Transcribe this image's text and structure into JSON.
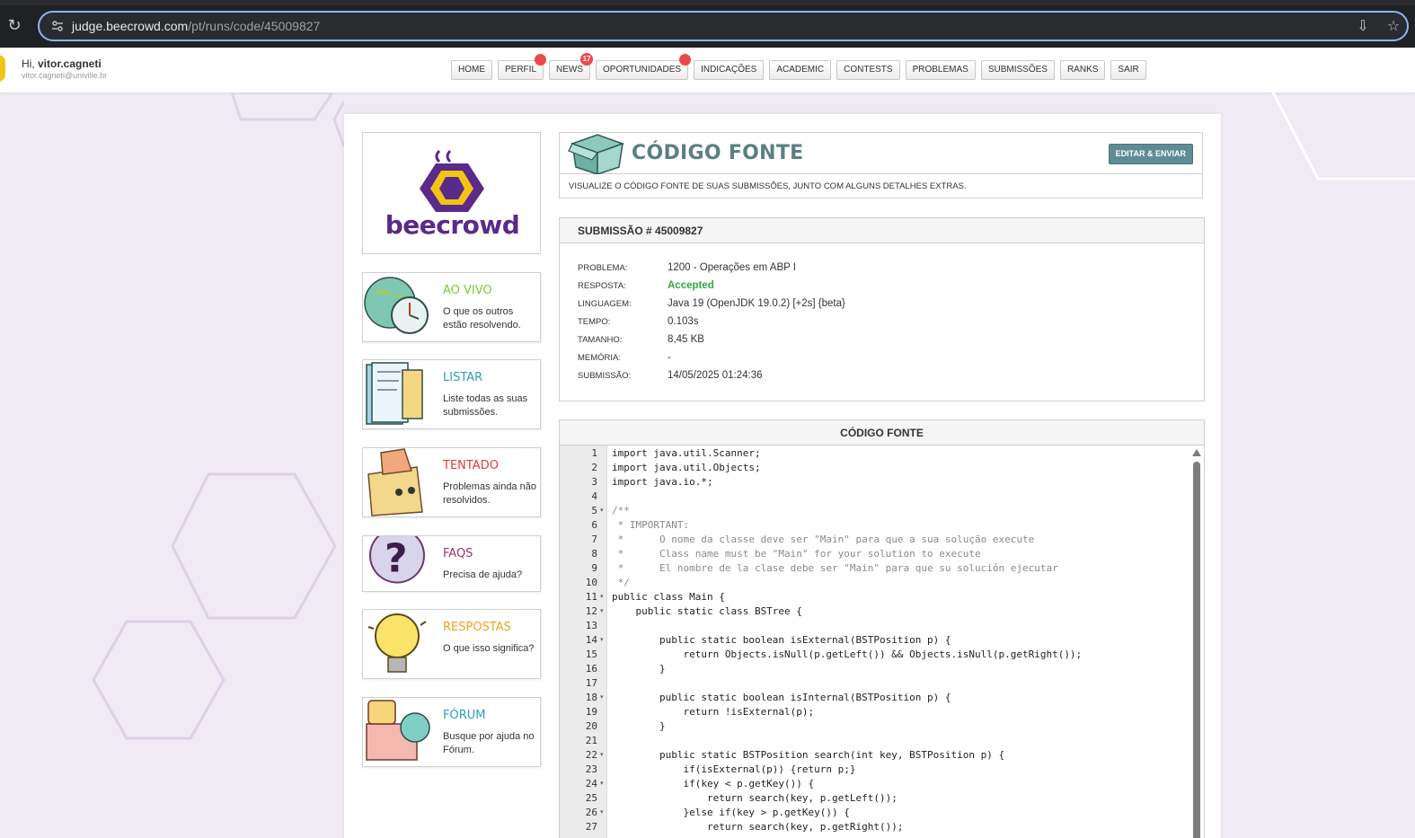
{
  "browser": {
    "url_host": "judge.beecrowd.com",
    "url_path": "/pt/runs/code/45009827"
  },
  "user": {
    "greeting_prefix": "Hi, ",
    "username": "vitor.cagneti",
    "email": "vitor.cagneti@univille.br"
  },
  "nav": {
    "items": [
      {
        "label": "HOME",
        "badge": ""
      },
      {
        "label": "PERFIL",
        "badge": ""
      },
      {
        "label": "NEWS",
        "badge": "17"
      },
      {
        "label": "OPORTUNIDADES",
        "badge": ""
      },
      {
        "label": "INDICAÇÕES",
        "badge": ""
      },
      {
        "label": "ACADEMIC",
        "badge": ""
      },
      {
        "label": "CONTESTS",
        "badge": ""
      },
      {
        "label": "PROBLEMAS",
        "badge": ""
      },
      {
        "label": "SUBMISSÕES",
        "badge": ""
      },
      {
        "label": "RANKS",
        "badge": ""
      },
      {
        "label": "SAIR",
        "badge": ""
      }
    ]
  },
  "logo": {
    "text": "beecrowd"
  },
  "sidebar": {
    "items": [
      {
        "title": "AO VIVO",
        "desc": "O que os outros estão resolvendo.",
        "color": "#7cc63a"
      },
      {
        "title": "LISTAR",
        "desc": "Liste todas as suas submissões.",
        "color": "#2aa0b8"
      },
      {
        "title": "TENTADO",
        "desc": "Problemas ainda não resolvidos.",
        "color": "#e23a3a"
      },
      {
        "title": "FAQS",
        "desc": "Precisa de ajuda?",
        "color": "#9b3470"
      },
      {
        "title": "RESPOSTAS",
        "desc": "O que isso significa?",
        "color": "#f2a01a"
      },
      {
        "title": "FÓRUM",
        "desc": "Busque por ajuda no Fórum.",
        "color": "#2aa0b8"
      }
    ]
  },
  "page": {
    "title": "CÓDIGO FONTE",
    "edit_button": "EDITAR & ENVIAR",
    "description": "VISUALIZE O CÓDIGO FONTE DE SUAS SUBMISSÕES, JUNTO COM ALGUNS DETALHES EXTRAS."
  },
  "submission": {
    "header": "SUBMISSÃO # 45009827",
    "details": [
      {
        "label": "PROBLEMA:",
        "value": "1200 - Operações em ABP I"
      },
      {
        "label": "RESPOSTA:",
        "value": "Accepted"
      },
      {
        "label": "LINGUAGEM:",
        "value": "Java 19 (OpenJDK 19.0.2) [+2s] {beta}"
      },
      {
        "label": "TEMPO:",
        "value": "0.103s"
      },
      {
        "label": "TAMANHO:",
        "value": "8,45 KB"
      },
      {
        "label": "MEMÓRIA:",
        "value": "-"
      },
      {
        "label": "SUBMISSÃO:",
        "value": "14/05/2025 01:24:36"
      }
    ]
  },
  "code": {
    "header": "CÓDIGO FONTE",
    "lines": [
      {
        "n": "1",
        "text": "import java.util.Scanner;",
        "fold": ""
      },
      {
        "n": "2",
        "text": "import java.util.Objects;",
        "fold": ""
      },
      {
        "n": "3",
        "text": "import java.io.*;",
        "fold": ""
      },
      {
        "n": "4",
        "text": "",
        "fold": ""
      },
      {
        "n": "5",
        "text": "/**",
        "fold": "▾"
      },
      {
        "n": "6",
        "text": " * IMPORTANT:",
        "fold": ""
      },
      {
        "n": "7",
        "text": " *      O nome da classe deve ser \"Main\" para que a sua solução execute",
        "fold": ""
      },
      {
        "n": "8",
        "text": " *      Class name must be \"Main\" for your solution to execute",
        "fold": ""
      },
      {
        "n": "9",
        "text": " *      El nombre de la clase debe ser \"Main\" para que su solución ejecutar",
        "fold": ""
      },
      {
        "n": "10",
        "text": " */",
        "fold": ""
      },
      {
        "n": "11",
        "text": "public class Main {",
        "fold": "▾"
      },
      {
        "n": "12",
        "text": "    public static class BSTree {",
        "fold": "▾"
      },
      {
        "n": "13",
        "text": "",
        "fold": ""
      },
      {
        "n": "14",
        "text": "        public static boolean isExternal(BSTPosition p) {",
        "fold": "▾"
      },
      {
        "n": "15",
        "text": "            return Objects.isNull(p.getLeft()) && Objects.isNull(p.getRight());",
        "fold": ""
      },
      {
        "n": "16",
        "text": "        }",
        "fold": ""
      },
      {
        "n": "17",
        "text": "",
        "fold": ""
      },
      {
        "n": "18",
        "text": "        public static boolean isInternal(BSTPosition p) {",
        "fold": "▾"
      },
      {
        "n": "19",
        "text": "            return !isExternal(p);",
        "fold": ""
      },
      {
        "n": "20",
        "text": "        }",
        "fold": ""
      },
      {
        "n": "21",
        "text": "",
        "fold": ""
      },
      {
        "n": "22",
        "text": "        public static BSTPosition search(int key, BSTPosition p) {",
        "fold": "▾"
      },
      {
        "n": "23",
        "text": "            if(isExternal(p)) {return p;}",
        "fold": ""
      },
      {
        "n": "24",
        "text": "            if(key < p.getKey()) {",
        "fold": "▾"
      },
      {
        "n": "25",
        "text": "                return search(key, p.getLeft());",
        "fold": ""
      },
      {
        "n": "26",
        "text": "            }else if(key > p.getKey()) {",
        "fold": "▾"
      },
      {
        "n": "27",
        "text": "                return search(key, p.getRight());",
        "fold": ""
      }
    ]
  },
  "colors": {
    "accent": "#5f8b96",
    "title": "#5b7f86",
    "accepted": "#2ea84a",
    "badge": "#ec4a4a",
    "brand_purple": "#5a2a8a",
    "brand_yellow": "#f2c414"
  }
}
